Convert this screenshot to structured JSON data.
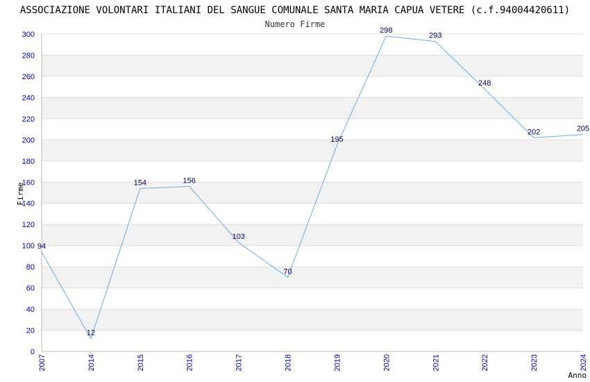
{
  "chart_data": {
    "type": "line",
    "title": "ASSOCIAZIONE VOLONTARI ITALIANI DEL SANGUE COMUNALE SANTA MARIA CAPUA VETERE (c.f.94004420611)",
    "subtitle": "Numero Firme",
    "xlabel": "Anno",
    "ylabel": "Firme",
    "categories": [
      "2007",
      "2014",
      "2015",
      "2016",
      "2017",
      "2018",
      "2019",
      "2020",
      "2021",
      "2022",
      "2023",
      "2024"
    ],
    "values": [
      94,
      12,
      154,
      156,
      103,
      70,
      195,
      298,
      293,
      248,
      202,
      205
    ],
    "ylim": [
      0,
      300
    ],
    "yticks": [
      0,
      20,
      40,
      60,
      80,
      100,
      120,
      140,
      160,
      180,
      200,
      220,
      240,
      260,
      280,
      300
    ],
    "grid": true,
    "colors": {
      "line": "#6aaae8",
      "band_alt": "#f2f2f2",
      "gridline": "#dddddd",
      "tick_text": "#0000aa",
      "label_text": "#000066"
    }
  }
}
